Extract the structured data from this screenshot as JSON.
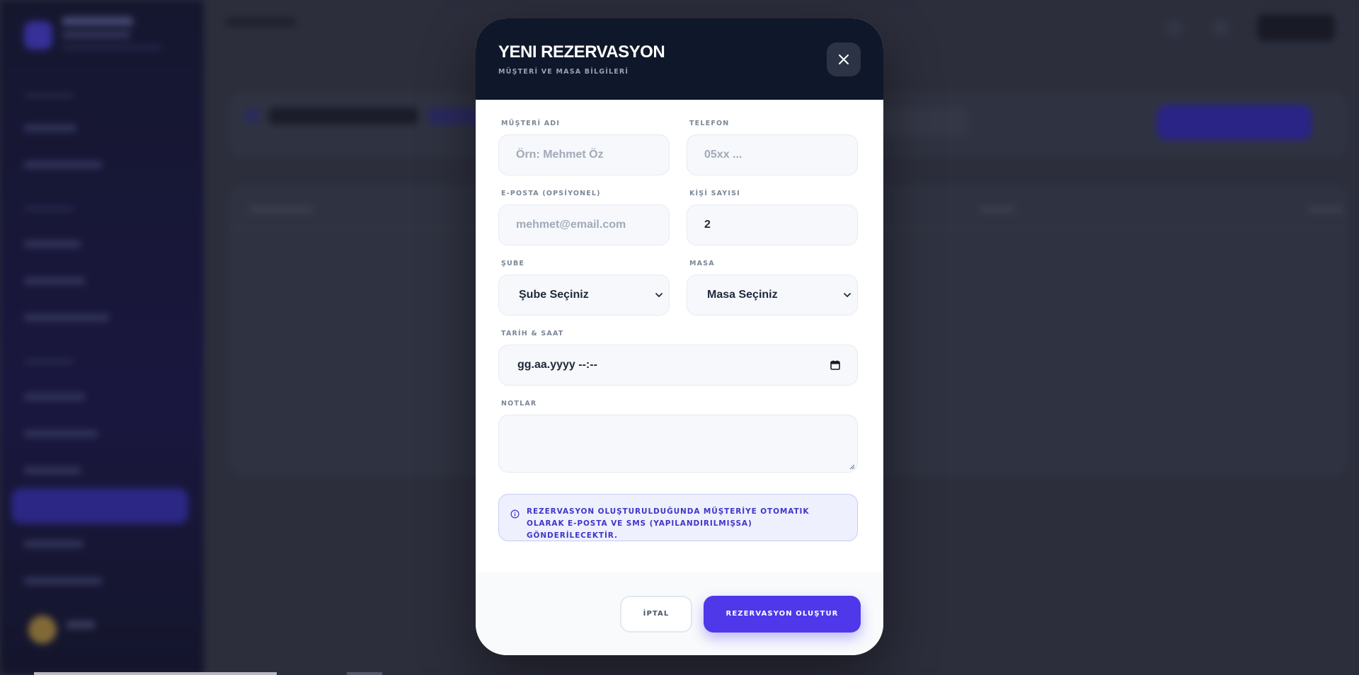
{
  "modal": {
    "title": "YENI REZERVASYON",
    "subtitle": "MÜŞTERİ VE MASA BİLGİLERİ",
    "close_icon": "close-icon",
    "fields": {
      "customer_name": {
        "label": "MÜŞTERİ ADI",
        "placeholder": "Örn: Mehmet Öz",
        "value": ""
      },
      "phone": {
        "label": "TELEFON",
        "placeholder": "05xx ...",
        "value": ""
      },
      "email": {
        "label": "E-POSTA (OPSİYONEL)",
        "placeholder": "mehmet@email.com",
        "value": ""
      },
      "guest_count": {
        "label": "KİŞİ SAYISI",
        "value": "2"
      },
      "branch": {
        "label": "ŞUBE",
        "selected": "Şube Seçiniz"
      },
      "table": {
        "label": "MASA",
        "selected": "Masa Seçiniz"
      },
      "datetime": {
        "label": "TARİH & SAAT",
        "value": "gg.aa.yyyy --:--"
      },
      "notes": {
        "label": "NOTLAR",
        "value": ""
      }
    },
    "info_text": "REZERVASYON OLUŞTURULDUĞUNDA MÜŞTERİYE OTOMATIK OLARAK E-POSTA VE SMS (YAPILANDIRILMIŞSA) GÖNDERİLECEKTİR.",
    "buttons": {
      "cancel": "İPTAL",
      "submit": "REZERVASYON OLUŞTUR"
    }
  },
  "colors": {
    "header_bg": "#0f172a",
    "accent": "#4f38ea",
    "info_text": "#3f36c9"
  }
}
